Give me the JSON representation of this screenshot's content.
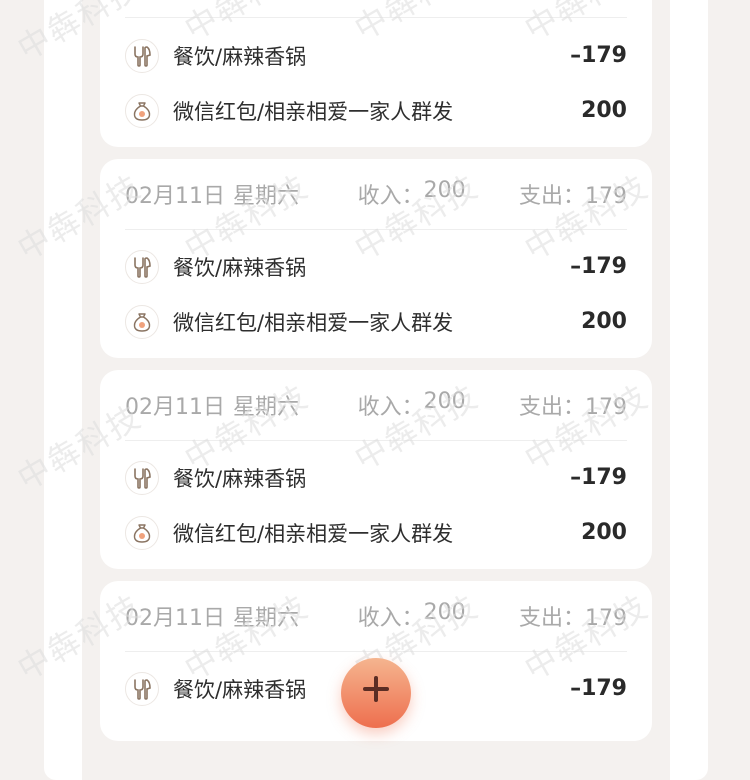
{
  "watermark": {
    "text": "中犇科技"
  },
  "days": [
    {
      "date": "",
      "weekday": "",
      "income_label": "",
      "income_value": "",
      "expense_label": "",
      "expense_value": "",
      "items": [
        {
          "icon": "utensils-icon",
          "label": "餐饮/麻辣香锅",
          "amount": "–179"
        },
        {
          "icon": "money-bag-icon",
          "label": "微信红包/相亲相爱一家人群发",
          "amount": "200"
        }
      ]
    },
    {
      "date": "02月11日",
      "weekday": "星期六",
      "income_label": "收入：",
      "income_value": "200",
      "expense_label": "支出：",
      "expense_value": "179",
      "items": [
        {
          "icon": "utensils-icon",
          "label": "餐饮/麻辣香锅",
          "amount": "–179"
        },
        {
          "icon": "money-bag-icon",
          "label": "微信红包/相亲相爱一家人群发",
          "amount": "200"
        }
      ]
    },
    {
      "date": "02月11日",
      "weekday": "星期六",
      "income_label": "收入：",
      "income_value": "200",
      "expense_label": "支出：",
      "expense_value": "179",
      "items": [
        {
          "icon": "utensils-icon",
          "label": "餐饮/麻辣香锅",
          "amount": "–179"
        },
        {
          "icon": "money-bag-icon",
          "label": "微信红包/相亲相爱一家人群发",
          "amount": "200"
        }
      ]
    },
    {
      "date": "02月11日",
      "weekday": "星期六",
      "income_label": "收入：",
      "income_value": "200",
      "expense_label": "支出：",
      "expense_value": "179",
      "items": [
        {
          "icon": "utensils-icon",
          "label": "餐饮/麻辣香锅",
          "amount": "–179"
        }
      ]
    }
  ],
  "fab": {
    "icon": "plus-icon"
  }
}
